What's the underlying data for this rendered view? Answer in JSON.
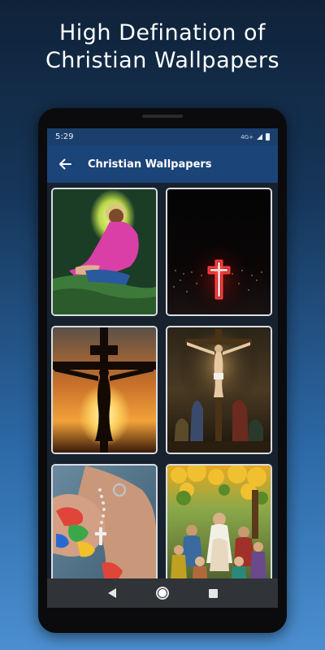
{
  "promo": {
    "line1": "High Defination of",
    "line2": "Christian Wallpapers"
  },
  "status_bar": {
    "time": "5:29",
    "network": "4G+"
  },
  "app_bar": {
    "title": "Christian Wallpapers"
  },
  "wallpapers": [
    {
      "subject": "Jesus praying in Gethsemane"
    },
    {
      "subject": "Glowing red neon cross over city at night"
    },
    {
      "subject": "Crucifix silhouette against orange sunset"
    },
    {
      "subject": "Crucifixion scene painting"
    },
    {
      "subject": "Hands holding rosary with crucifix"
    },
    {
      "subject": "Jesus with children under a tree"
    }
  ],
  "nav": {
    "back": "back-icon",
    "home": "home-icon",
    "recents": "recents-icon"
  }
}
